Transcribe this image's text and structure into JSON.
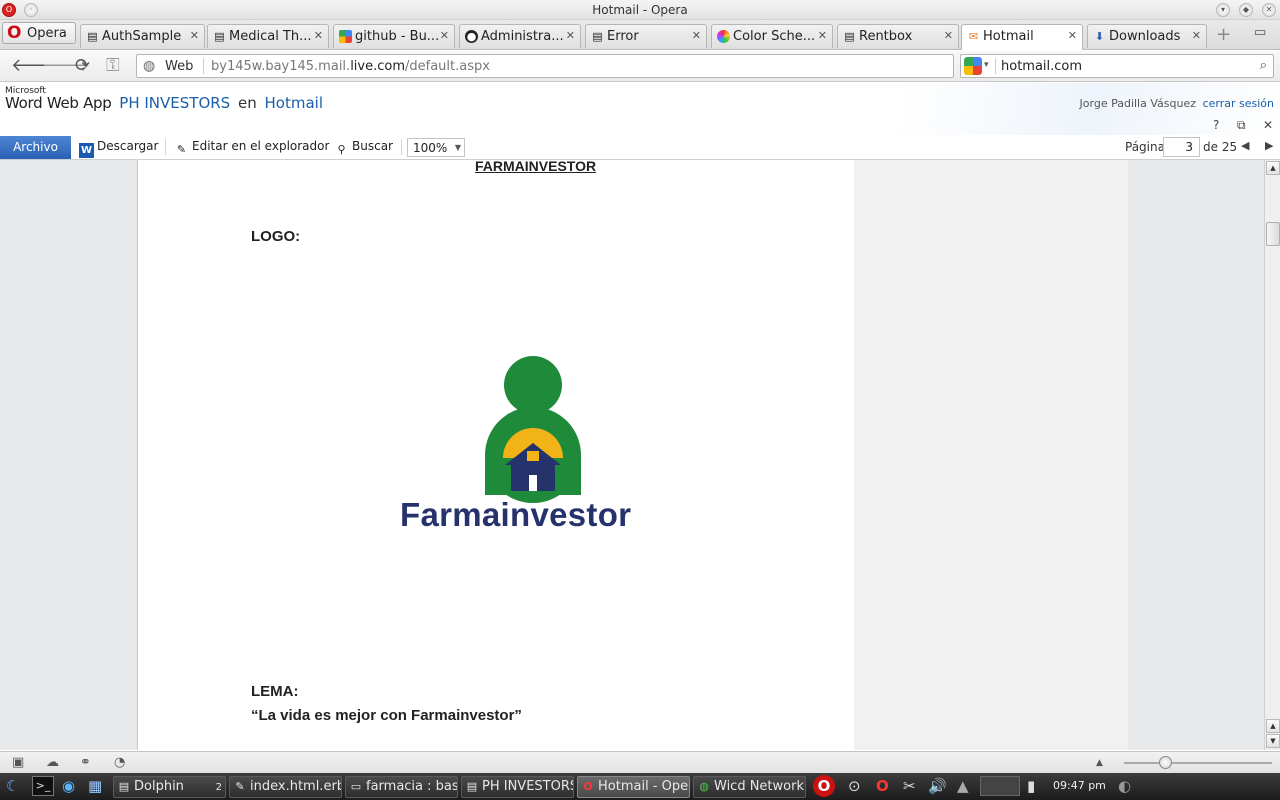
{
  "window": {
    "title": "Hotmail - Opera"
  },
  "opera_button": {
    "label": "Opera"
  },
  "tabs": [
    {
      "label": "AuthSample",
      "icon": "page-icon"
    },
    {
      "label": "Medical Th...",
      "icon": "page-icon"
    },
    {
      "label": "github - Bu...",
      "icon": "google-icon"
    },
    {
      "label": "Administra...",
      "icon": "github-icon"
    },
    {
      "label": "Error",
      "icon": "page-icon"
    },
    {
      "label": "Color Sche...",
      "icon": "color-wheel-icon"
    },
    {
      "label": "Rentbox",
      "icon": "page-icon"
    },
    {
      "label": "Hotmail",
      "icon": "hotmail-icon",
      "active": true
    },
    {
      "label": "Downloads",
      "icon": "download-icon"
    }
  ],
  "address": {
    "badge": "Web",
    "url_prefix": "by145w.bay145.mail.",
    "url_domain": "live.com",
    "url_suffix": "/default.aspx"
  },
  "search": {
    "query": "hotmail.com"
  },
  "app": {
    "microsoft": "Microsoft",
    "product": "Word Web App",
    "document": "PH INVESTORS",
    "connector": "en",
    "service": "Hotmail",
    "user": "Jorge Padilla Vásquez",
    "signout": "cerrar sesión"
  },
  "ribbon": {
    "file": "Archivo",
    "download": "Descargar",
    "edit_in_browser": "Editar en el explorador",
    "find": "Buscar",
    "zoom": "100%",
    "page_label": "Página",
    "page_current": "3",
    "page_of": "de 25"
  },
  "document": {
    "title": "FARMAINVESTOR",
    "logo_heading": "LOGO:",
    "logo_text": "Farmainvestor",
    "motto_heading": "LEMA:",
    "motto": "“La vida es mejor con Farmainvestor”"
  },
  "taskbar": {
    "items": [
      {
        "label": "Dolphin",
        "badge": "2"
      },
      {
        "label": "index.html.erb"
      },
      {
        "label": "farmacia : bas"
      },
      {
        "label": "PH INVESTORS"
      },
      {
        "label": "Hotmail - Oper",
        "active": true
      },
      {
        "label": "Wicd Network"
      }
    ],
    "clock": "09:47 pm"
  },
  "colors": {
    "accent": "#2b61b6",
    "logo_green": "#1f8a3a",
    "logo_yellow": "#f2b316",
    "logo_navy": "#26326b"
  }
}
